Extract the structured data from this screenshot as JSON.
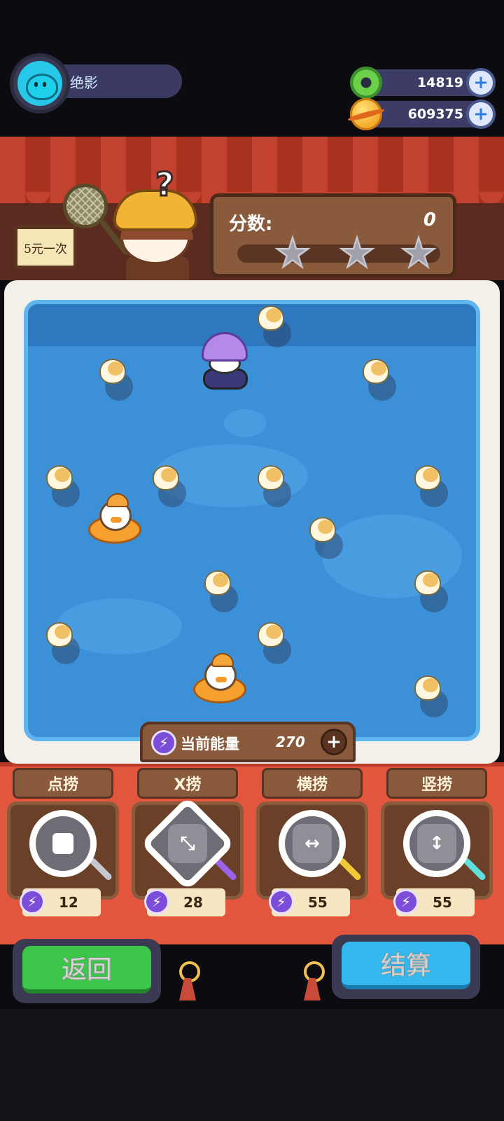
{
  "player": {
    "name": "绝影"
  },
  "currencies": [
    {
      "icon": "donut-icon",
      "value": "14819"
    },
    {
      "icon": "planet-icon",
      "value": "609375"
    }
  ],
  "stall": {
    "price_sign": "5元一次"
  },
  "score": {
    "label": "分数:",
    "value": "0",
    "stars_earned": 0,
    "stars_total": 3
  },
  "energy": {
    "label": "当前能量",
    "value": "270"
  },
  "tools": [
    {
      "label": "点捞",
      "cost": "12",
      "icon": "dot-net-icon"
    },
    {
      "label": "X捞",
      "cost": "28",
      "icon": "x-net-icon"
    },
    {
      "label": "横捞",
      "cost": "55",
      "icon": "horizontal-net-icon"
    },
    {
      "label": "竖捞",
      "cost": "55",
      "icon": "vertical-net-icon"
    }
  ],
  "buttons": {
    "back": "返回",
    "settle": "结算"
  },
  "colors": {
    "pond": "#3c90d8",
    "back_button": "#3cc64a",
    "settle_button": "#35b8ee",
    "awning": "#c2412f"
  }
}
